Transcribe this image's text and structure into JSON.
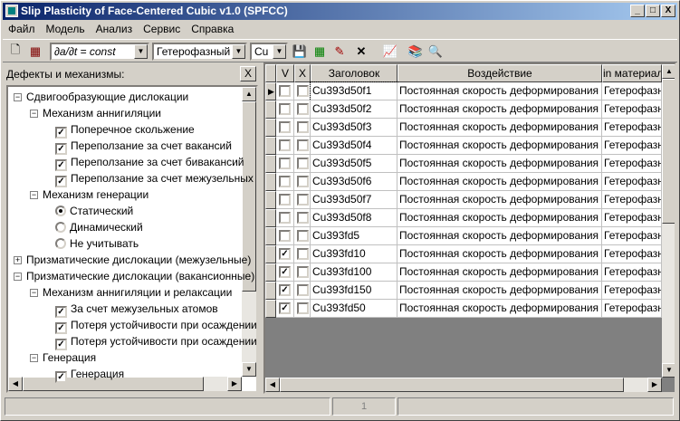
{
  "window": {
    "title": "Slip Plasticity of Face-Centered Cubic v1.0 (SPFCC)",
    "minimize": "_",
    "maximize": "□",
    "close": "X"
  },
  "menu": [
    "Файл",
    "Модель",
    "Анализ",
    "Сервис",
    "Справка"
  ],
  "toolbar": {
    "icons": [
      "new-file-icon",
      "calendar-icon",
      "save-icon",
      "grid-icon",
      "edit-icon",
      "delete-icon",
      "chart-icon",
      "books-icon",
      "search-icon"
    ],
    "icon_glyphs": {
      "new": "🗋",
      "calendar": "▦",
      "save": "💾",
      "grid": "▦",
      "edit": "✎",
      "delete": "✕",
      "chart": "📈",
      "books": "📚",
      "search": "🔍"
    },
    "rate_combo": "∂a/∂t   = const",
    "phase_combo": "Гетерофазный",
    "material_combo": "Cu"
  },
  "left_panel": {
    "title": "Дефекты и механизмы:",
    "close": "X",
    "tree": [
      {
        "level": 0,
        "expander": "−",
        "type": "text",
        "label": "Сдвигообразующие дислокации"
      },
      {
        "level": 1,
        "expander": "−",
        "type": "text",
        "label": "Механизм аннигиляции"
      },
      {
        "level": 2,
        "type": "checkbox",
        "checked": true,
        "label": "Поперечное скольжение"
      },
      {
        "level": 2,
        "type": "checkbox",
        "checked": true,
        "label": "Переползание за счет вакансий"
      },
      {
        "level": 2,
        "type": "checkbox",
        "checked": true,
        "label": "Переползание за счет бивакансий"
      },
      {
        "level": 2,
        "type": "checkbox",
        "checked": true,
        "label": "Переползание за счет межузельных"
      },
      {
        "level": 1,
        "expander": "−",
        "type": "text",
        "label": "Механизм генерации"
      },
      {
        "level": 2,
        "type": "radio",
        "checked": true,
        "label": "Статический"
      },
      {
        "level": 2,
        "type": "radio",
        "checked": false,
        "label": "Динамический"
      },
      {
        "level": 2,
        "type": "radio",
        "checked": false,
        "label": "Не учитывать"
      },
      {
        "level": 0,
        "expander": "+",
        "type": "text",
        "label": "Призматические дислокации (межузельные)"
      },
      {
        "level": 0,
        "expander": "−",
        "type": "text",
        "label": "Призматические дислокации (вакансионные)"
      },
      {
        "level": 1,
        "expander": "−",
        "type": "text",
        "label": "Механизм аннигиляции и релаксации"
      },
      {
        "level": 2,
        "type": "checkbox",
        "checked": true,
        "label": "За счет межузельных атомов"
      },
      {
        "level": 2,
        "type": "checkbox",
        "checked": true,
        "label": "Потеря устойчивости при осаждении"
      },
      {
        "level": 2,
        "type": "checkbox",
        "checked": true,
        "label": "Потеря устойчивости при осаждении"
      },
      {
        "level": 1,
        "expander": "−",
        "type": "text",
        "label": "Генерация"
      },
      {
        "level": 2,
        "type": "checkbox",
        "checked": true,
        "label": "Генерация"
      }
    ]
  },
  "grid": {
    "columns": [
      "V",
      "X",
      "Заголовок",
      "Воздействие",
      "in материал"
    ],
    "rows": [
      {
        "v": false,
        "x": false,
        "title": "Cu393d50f1",
        "action": "Постоянная скорость деформирования",
        "material": "Гетерофазный",
        "current": true
      },
      {
        "v": false,
        "x": false,
        "title": "Cu393d50f2",
        "action": "Постоянная скорость деформирования",
        "material": "Гетерофазный"
      },
      {
        "v": false,
        "x": false,
        "title": "Cu393d50f3",
        "action": "Постоянная скорость деформирования",
        "material": "Гетерофазный"
      },
      {
        "v": false,
        "x": false,
        "title": "Cu393d50f4",
        "action": "Постоянная скорость деформирования",
        "material": "Гетерофазный"
      },
      {
        "v": false,
        "x": false,
        "title": "Cu393d50f5",
        "action": "Постоянная скорость деформирования",
        "material": "Гетерофазный"
      },
      {
        "v": false,
        "x": false,
        "title": "Cu393d50f6",
        "action": "Постоянная скорость деформирования",
        "material": "Гетерофазный"
      },
      {
        "v": false,
        "x": false,
        "title": "Cu393d50f7",
        "action": "Постоянная скорость деформирования",
        "material": "Гетерофазный"
      },
      {
        "v": false,
        "x": false,
        "title": "Cu393d50f8",
        "action": "Постоянная скорость деформирования",
        "material": "Гетерофазный"
      },
      {
        "v": false,
        "x": false,
        "title": "Cu393fd5",
        "action": "Постоянная скорость деформирования",
        "material": "Гетерофазный"
      },
      {
        "v": true,
        "x": false,
        "title": "Cu393fd10",
        "action": "Постоянная скорость деформирования",
        "material": "Гетерофазный"
      },
      {
        "v": true,
        "x": false,
        "title": "Cu393fd100",
        "action": "Постоянная скорость деформирования",
        "material": "Гетерофазный"
      },
      {
        "v": true,
        "x": false,
        "title": "Cu393fd150",
        "action": "Постоянная скорость деформирования",
        "material": "Гетерофазный"
      },
      {
        "v": true,
        "x": false,
        "title": "Cu393fd50",
        "action": "Постоянная скорость деформирования",
        "material": "Гетерофазный"
      }
    ]
  },
  "status": {
    "panel3": "1"
  }
}
